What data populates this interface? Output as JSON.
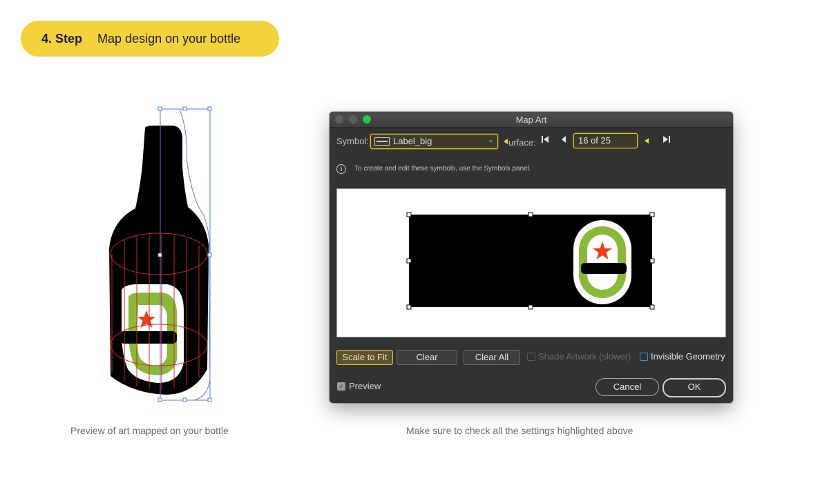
{
  "step": {
    "number": "4. Step",
    "title": "Map design on your bottle"
  },
  "captions": {
    "left": "Preview of art mapped on your bottle",
    "right": "Make sure to check all the settings highlighted above"
  },
  "dialog": {
    "title": "Map Art",
    "symbol_label": "Symbol:",
    "symbol_value": "Label_big",
    "surface_label": "urface:",
    "surface_value": "16 of 25",
    "info_text": "To create and edit these symbols, use the Symbols panel.",
    "buttons": {
      "scale_to_fit": "Scale to Fit",
      "clear": "Clear",
      "clear_all": "Clear All",
      "cancel": "Cancel",
      "ok": "OK"
    },
    "checkboxes": {
      "shade_artwork": "Shade Artwork (slower)",
      "invisible_geometry": "Invisible Geometry",
      "preview": "Preview"
    }
  },
  "colors": {
    "pill": "#f3d23e",
    "dialog_bg": "#323232",
    "highlight": "#e8c830",
    "label_green": "#8ab83a",
    "star_red": "#e8401c",
    "selection_blue": "#5b7bd5",
    "mesh_red": "#cc2a1e"
  },
  "icons": {
    "symbol": "symbol-icon",
    "info": "info-icon",
    "first": "first-icon",
    "previous": "previous-icon",
    "last": "last-icon"
  }
}
